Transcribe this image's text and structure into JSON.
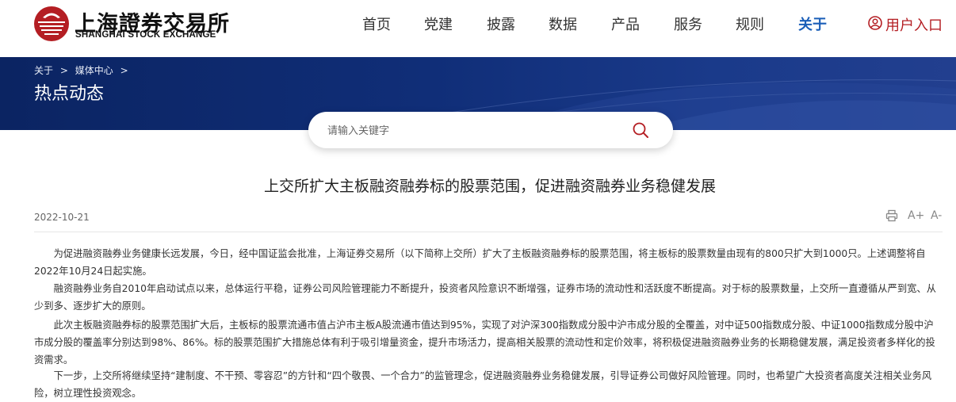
{
  "header": {
    "logo_cn": "上海證券交易所",
    "logo_en": "SHANGHAI STOCK EXCHANGE",
    "nav": [
      "首页",
      "党建",
      "披露",
      "数据",
      "产品",
      "服务",
      "规则",
      "关于"
    ],
    "active_nav": "关于",
    "login_label": "用户入口"
  },
  "banner": {
    "breadcrumb": [
      "关于",
      "媒体中心"
    ],
    "title": "热点动态"
  },
  "search": {
    "placeholder": "请输入关键字"
  },
  "article": {
    "title": "上交所扩大主板融资融券标的股票范围，促进融资融券业务稳健发展",
    "date": "2022-10-21",
    "tools": {
      "print_icon": "printer-icon",
      "font_increase": "A+",
      "font_decrease": "A-"
    },
    "paragraphs": [
      "为促进融资融券业务健康长远发展，今日，经中国证监会批准，上海证券交易所（以下简称上交所）扩大了主板融资融券标的股票范围，将主板标的股票数量由现有的800只扩大到1000只。上述调整将自2022年10月24日起实施。",
      "融资融券业务自2010年启动试点以来，总体运行平稳，证券公司风险管理能力不断提升，投资者风险意识不断增强，证券市场的流动性和活跃度不断提高。对于标的股票数量，上交所一直遵循从严到宽、从少到多、逐步扩大的原则。",
      "此次主板融资融券标的股票范围扩大后，主板标的股票流通市值占沪市主板A股流通市值达到95%，实现了对沪深300指数成分股中沪市成分股的全覆盖，对中证500指数成分股、中证1000指数成分股中沪市成分股的覆盖率分别达到98%、86%。标的股票范围扩大措施总体有利于吸引增量资金，提升市场活力，提高相关股票的流动性和定价效率，将积极促进融资融券业务的长期稳健发展，满足投资者多样化的投资需求。",
      "下一步，上交所将继续坚持“建制度、不干预、零容忍”的方针和“四个敬畏、一个合力”的监管理念，促进融资融券业务稳健发展，引导证券公司做好风险管理。同时，也希望广大投资者高度关注相关业务风险，树立理性投资观念。"
    ]
  },
  "colors": {
    "brand_red": "#b41e23",
    "active_blue": "#1a5eb8",
    "banner_navy": "#102e78"
  }
}
